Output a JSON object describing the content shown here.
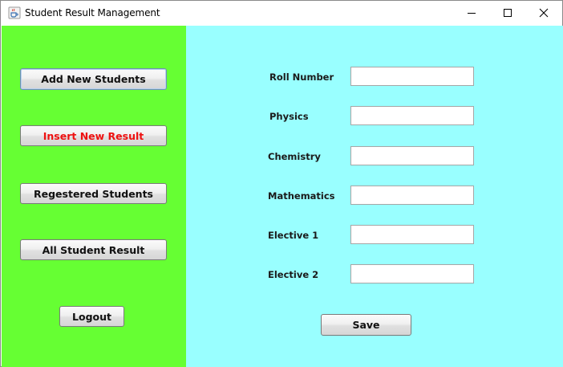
{
  "window": {
    "title": "Student Result Management"
  },
  "sidebar": {
    "buttons": [
      {
        "label": "Add New Students"
      },
      {
        "label": "Insert New Result"
      },
      {
        "label": "Regestered Students"
      },
      {
        "label": "All Student Result"
      },
      {
        "label": "Logout"
      }
    ],
    "background": "#66ff33",
    "active_text_color": "#ee1111"
  },
  "form": {
    "background": "#99ffff",
    "fields": [
      {
        "label": "Roll Number",
        "value": ""
      },
      {
        "label": "Physics",
        "value": ""
      },
      {
        "label": "Chemistry",
        "value": ""
      },
      {
        "label": "Mathematics",
        "value": ""
      },
      {
        "label": "Elective 1",
        "value": ""
      },
      {
        "label": "Elective 2",
        "value": ""
      }
    ],
    "save_label": "Save"
  },
  "icons": {
    "app": "java-coffee-cup-icon",
    "minimize": "minimize-icon",
    "maximize": "maximize-icon",
    "close": "close-icon"
  }
}
